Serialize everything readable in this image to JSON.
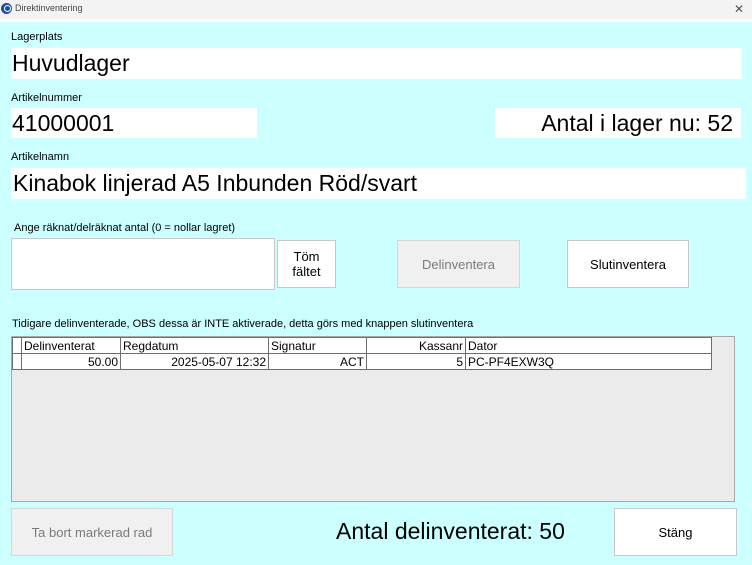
{
  "window": {
    "title": "Direktinventering",
    "icon": "app-logo-icon",
    "close_icon": "close-icon"
  },
  "lagerplats": {
    "label": "Lagerplats",
    "value": "Huvudlager"
  },
  "artikelnummer": {
    "label": "Artikelnummer",
    "value": "41000001"
  },
  "stock": {
    "text": "Antal i lager nu: 52"
  },
  "artikelnamn": {
    "label": "Artikelnamn",
    "value": "Kinabok linjerad A5 Inbunden Röd/svart"
  },
  "count": {
    "label": "Ange räknat/delräknat antal (0 = nollar lagret)",
    "value": ""
  },
  "buttons": {
    "clear_line1": "Töm",
    "clear_line2": "fältet",
    "partial": "Delinventera",
    "final": "Slutinventera",
    "remove_row": "Ta bort markerad rad",
    "close": "Stäng"
  },
  "history": {
    "note": "Tidigare delinventerade, OBS dessa är INTE aktiverade, detta görs med knappen slutinventera",
    "columns": [
      "Delinventerat",
      "Regdatum",
      "Signatur",
      "Kassanr",
      "Dator"
    ],
    "rows": [
      [
        "50.00",
        "2025-05-07 12:32",
        "ACT",
        "5",
        "PC-PF4EXW3Q"
      ]
    ]
  },
  "total": {
    "text": "Antal delinventerat: 50"
  },
  "colors": {
    "background": "#ccffff",
    "field": "#ffffff"
  }
}
